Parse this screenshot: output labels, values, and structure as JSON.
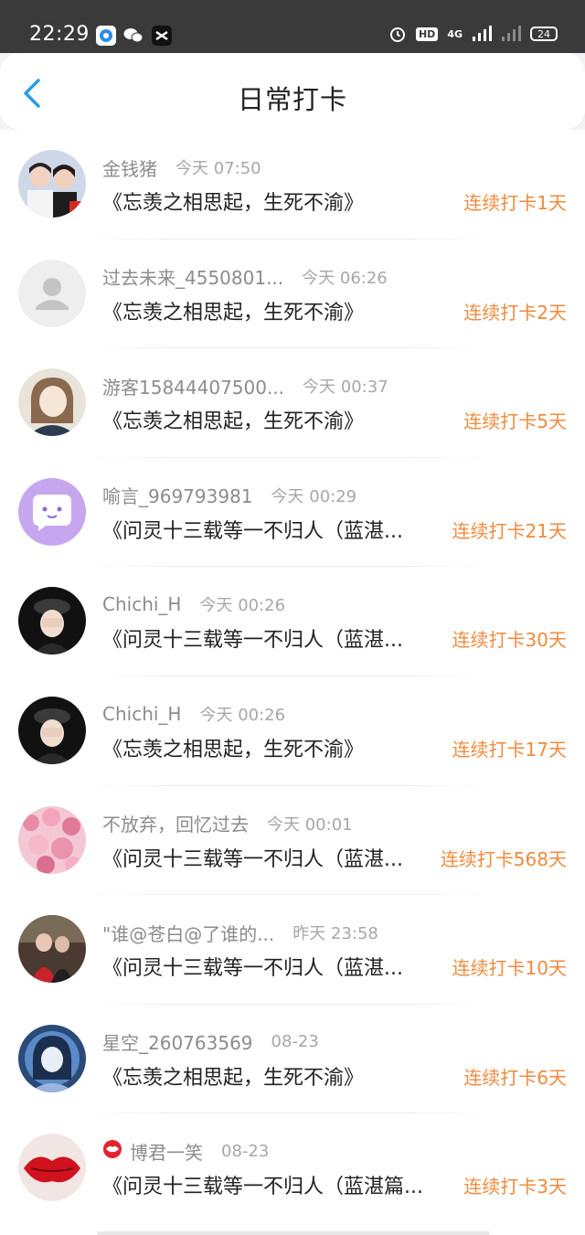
{
  "status_bar": {
    "time": "22:29",
    "hd": "HD",
    "network": "4G",
    "battery": "24"
  },
  "nav": {
    "title": "日常打卡"
  },
  "colors": {
    "accent": "#f08a3c",
    "back": "#2a9be8"
  },
  "checkins": [
    {
      "username": "金钱猪",
      "time": "今天 07:50",
      "book": "《忘羡之相思起，生死不渝》",
      "streak": "连续打卡1天",
      "avatar": "photo-two-women"
    },
    {
      "username": "过去未来_4550801...",
      "time": "今天 06:26",
      "book": "《忘羡之相思起，生死不渝》",
      "streak": "连续打卡2天",
      "avatar": "default-user"
    },
    {
      "username": "游客15844407500...",
      "time": "今天 00:37",
      "book": "《忘羡之相思起，生死不渝》",
      "streak": "连续打卡5天",
      "avatar": "anime-girl"
    },
    {
      "username": "喻言_969793981",
      "time": "今天 00:29",
      "book": "《问灵十三载等一不归人（蓝湛...",
      "streak": "连续打卡21天",
      "avatar": "chat-bubble"
    },
    {
      "username": "Chichi_H",
      "time": "今天 00:26",
      "book": "《问灵十三载等一不归人（蓝湛...",
      "streak": "连续打卡30天",
      "avatar": "girl-hat-dark"
    },
    {
      "username": "Chichi_H",
      "time": "今天 00:26",
      "book": "《忘羡之相思起，生死不渝》",
      "streak": "连续打卡17天",
      "avatar": "girl-hat-dark"
    },
    {
      "username": "不放弃，回忆过去",
      "time": "今天 00:01",
      "book": "《问灵十三载等一不归人（蓝湛...",
      "streak": "连续打卡568天",
      "avatar": "pink-blossoms"
    },
    {
      "username": "\"谁@苍白@了谁的...",
      "time": "昨天 23:58",
      "book": "《问灵十三载等一不归人（蓝湛...",
      "streak": "连续打卡10天",
      "avatar": "couple-red"
    },
    {
      "username": "星空_260763569",
      "time": "08-23",
      "book": "《忘羡之相思起，生死不渝》",
      "streak": "连续打卡6天",
      "avatar": "anime-blue"
    },
    {
      "username": "博君一笑",
      "time": "08-23",
      "book": "《问灵十三载等一不归人（蓝湛篇...",
      "streak": "连续打卡3天",
      "avatar": "red-lips",
      "vip": true
    }
  ]
}
